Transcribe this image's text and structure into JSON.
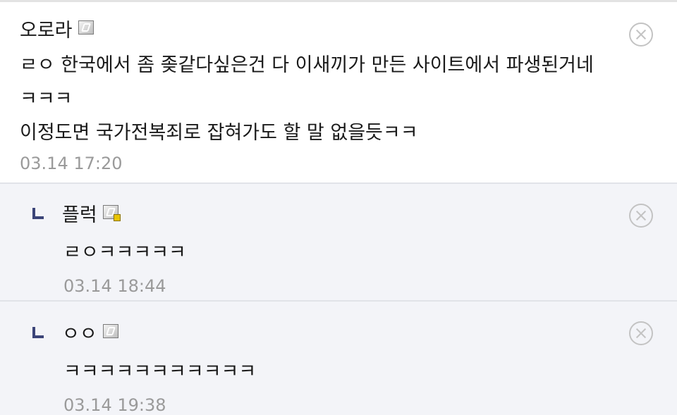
{
  "comments": [
    {
      "author": "오로라",
      "level_icon": "member-level-icon",
      "lines": [
        "ㄹㅇ 한국에서 좀 좆같다싶은건 다 이새끼가 만든 사이트에서 파생된거네ㅋㅋㅋ",
        "이정도면 국가전복죄로 잡혀가도 할 말 없을듯ㅋㅋ"
      ],
      "timestamp": "03.14 17:20"
    }
  ],
  "replies": [
    {
      "author": "플럭",
      "level_icon": "member-level-icon-gold",
      "text": "ㄹㅇㅋㅋㅋㅋㅋ",
      "timestamp": "03.14 18:44"
    },
    {
      "author": "ㅇㅇ",
      "level_icon": "member-level-icon",
      "text": "ㅋㅋㅋㅋㅋㅋㅋㅋㅋㅋㅋ",
      "timestamp": "03.14 19:38"
    }
  ],
  "colors": {
    "reply_background": "#f3f4f8",
    "reply_arrow": "#3b4478",
    "timestamp": "#9a9a9a",
    "delete_icon": "#c3c3c3"
  }
}
